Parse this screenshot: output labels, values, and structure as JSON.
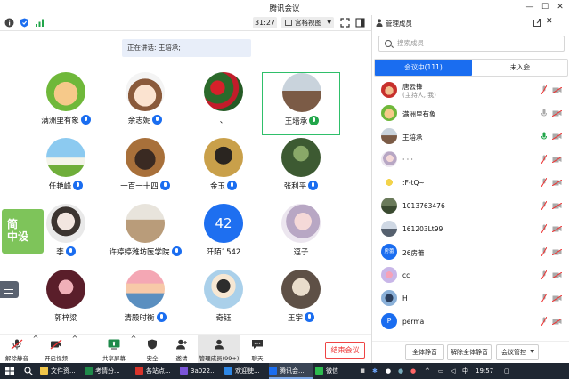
{
  "window": {
    "title": "腾讯会议",
    "minimize_glyph": "—",
    "maximize_glyph": "☐",
    "close_glyph": "✕"
  },
  "toolbar": {
    "timer": "31:27",
    "view_mode": "宫格视图"
  },
  "speaking": "正在讲话: 王培承;",
  "participants": [
    {
      "name": "满洲里有象",
      "mic": "on"
    },
    {
      "name": "余志妮",
      "mic": "on"
    },
    {
      "name": "、",
      "mic": "none"
    },
    {
      "name": "王培承",
      "mic": "speaking",
      "active": true
    },
    {
      "name": "任艳峰",
      "mic": "on"
    },
    {
      "name": "一百一十四",
      "mic": "on"
    },
    {
      "name": "金玉",
      "mic": "on"
    },
    {
      "name": "张利平",
      "mic": "on"
    },
    {
      "name": "李",
      "mic": "on"
    },
    {
      "name": "许婷婷潍坊医学院",
      "mic": "on"
    },
    {
      "name": "阡陌1542",
      "mic": "none",
      "avatar_text": "42"
    },
    {
      "name": "逗子",
      "mic": "none"
    },
    {
      "name": "郭梓粱",
      "mic": "none"
    },
    {
      "name": "清殿时衡",
      "mic": "on"
    },
    {
      "name": "奇钰",
      "mic": "none"
    },
    {
      "name": "王宇",
      "mic": "on"
    }
  ],
  "float_thumb_text": "简\n中设",
  "bottom": {
    "mute": "解除静音",
    "video": "开启视频",
    "share": "共享屏幕",
    "security": "安全",
    "invite": "邀请",
    "members": "管理成员(99+)",
    "chat": "聊天",
    "end": "结束会议"
  },
  "panel": {
    "title": "管理成员",
    "search_placeholder": "搜索成员",
    "tab_in": "会议中(111)",
    "tab_out": "未入会",
    "members": [
      {
        "name": "唐云锋",
        "sub": "(主持人, 我)",
        "mic": "muted"
      },
      {
        "name": "满洲里有象",
        "mic": "off"
      },
      {
        "name": "王培承",
        "mic": "speaking"
      },
      {
        "name": "· · ·",
        "mic": "muted"
      },
      {
        "name": ":F-tQ~",
        "mic": "muted"
      },
      {
        "name": "1013763476",
        "mic": "muted"
      },
      {
        "name": "161203Lt99",
        "mic": "muted"
      },
      {
        "name": "26房蕾",
        "mic": "muted",
        "avatar_text": "房蕾"
      },
      {
        "name": "cc",
        "mic": "muted"
      },
      {
        "name": "H",
        "mic": "muted"
      },
      {
        "name": "perma",
        "mic": "muted",
        "avatar_text": "P"
      }
    ],
    "mute_all": "全体静音",
    "unmute_all": "解除全体静音",
    "control": "会议管控"
  },
  "taskbar": {
    "items": [
      "文件资...",
      "考情分...",
      "各站点...",
      "3a022...",
      "欢迎使...",
      "腾讯会...",
      "微信"
    ],
    "time": "19:57",
    "ime": "中"
  }
}
